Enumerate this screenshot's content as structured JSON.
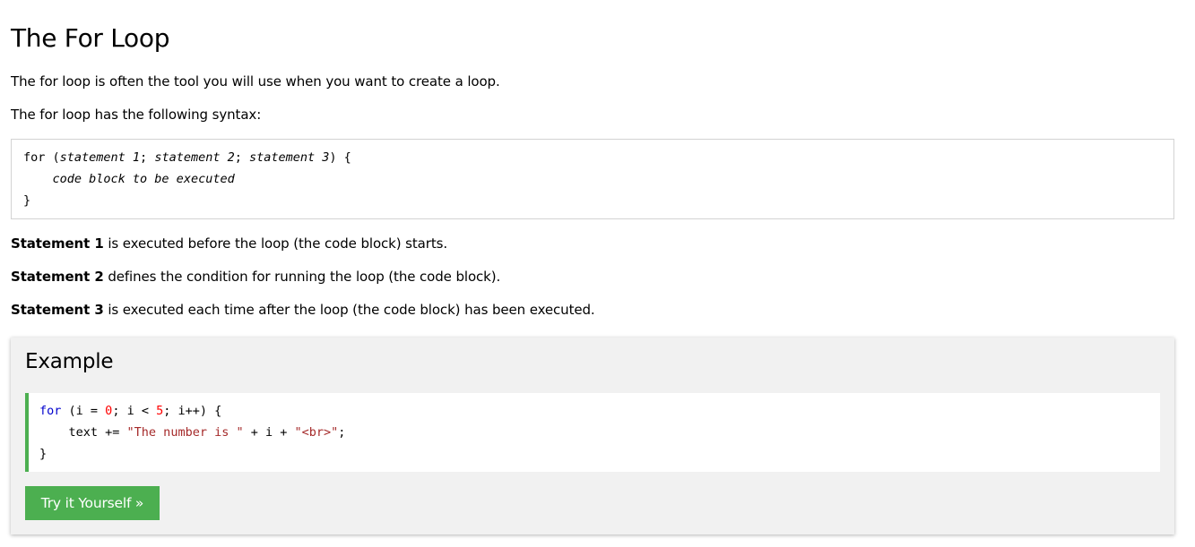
{
  "page": {
    "title": "The For Loop",
    "intro": "The for loop is often the tool you will use when you want to create a loop.",
    "syntax_intro": "The for loop has the following syntax:"
  },
  "syntax": {
    "line1_for": "for (",
    "line1_s1": "statement 1",
    "line1_sep1": "; ",
    "line1_s2": "statement 2",
    "line1_sep2": "; ",
    "line1_s3": "statement 3",
    "line1_end": ") {",
    "line2_indent": "    ",
    "line2_block": "code block to be executed",
    "line3": "}"
  },
  "statements": [
    {
      "label": "Statement 1",
      "text": " is executed before the loop (the code block) starts."
    },
    {
      "label": "Statement 2",
      "text": " defines the condition for running the loop (the code block)."
    },
    {
      "label": "Statement 3",
      "text": " is executed each time after the loop (the code block) has been executed."
    }
  ],
  "example": {
    "heading": "Example",
    "code": {
      "l1_kw": "for",
      "l1_a": " (i = ",
      "l1_n0": "0",
      "l1_b": "; i < ",
      "l1_n5": "5",
      "l1_c": "; i++) {",
      "l2_a": "    text += ",
      "l2_s1": "\"The number is \"",
      "l2_b": " + i + ",
      "l2_s2": "\"<br>\"",
      "l2_c": ";",
      "l3": "}"
    },
    "button_label": "Try it Yourself »"
  },
  "colors": {
    "accent": "#4caf50",
    "panel_bg": "#f1f1f1",
    "keyword": "#0000cd",
    "number": "#ff0000",
    "string": "#a52a2a",
    "border": "#d3d3d3"
  }
}
